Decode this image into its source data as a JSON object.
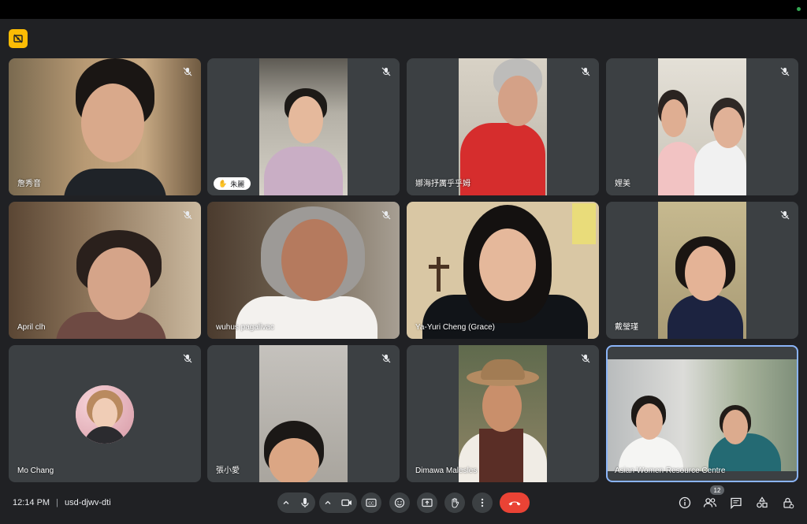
{
  "meeting": {
    "time": "12:14 PM",
    "separator": "|",
    "code": "usd-djwv-dti",
    "participant_count": "12"
  },
  "participants": [
    {
      "name": "詹秀音",
      "muted": true
    },
    {
      "name": "朱麗",
      "muted": true,
      "hand_raised": true
    },
    {
      "name": "娜海抒厲乎乎姆",
      "muted": true
    },
    {
      "name": "娌美",
      "muted": true
    },
    {
      "name": "April clh",
      "muted": true
    },
    {
      "name": "wuhus pagalivac",
      "muted": true
    },
    {
      "name": "Ya-Yuri Cheng (Grace)",
      "muted": false
    },
    {
      "name": "戴瑩瑾",
      "muted": true
    },
    {
      "name": "Mo Chang",
      "muted": true
    },
    {
      "name": "張小愛",
      "muted": true
    },
    {
      "name": "Dimawa Malesles",
      "muted": true
    },
    {
      "name": "Asian Women Resource Centre",
      "muted": false,
      "active_speaker": true
    }
  ],
  "icons": {
    "recording": "recording-off-icon",
    "mic": "mic-icon",
    "camera": "camera-icon",
    "captions": "captions-icon",
    "emoji": "emoji-icon",
    "present": "present-screen-icon",
    "raise_hand": "raise-hand-icon",
    "more": "more-vert-icon",
    "end_call": "end-call-icon",
    "info": "info-icon",
    "people": "people-icon",
    "chat": "chat-icon",
    "activities": "activities-icon",
    "host_controls": "host-controls-icon"
  },
  "colors": {
    "background": "#202124",
    "tile": "#3c4043",
    "active_outline": "#8ab4f8",
    "end_call": "#ea4335",
    "record_badge": "#fbbc04"
  }
}
